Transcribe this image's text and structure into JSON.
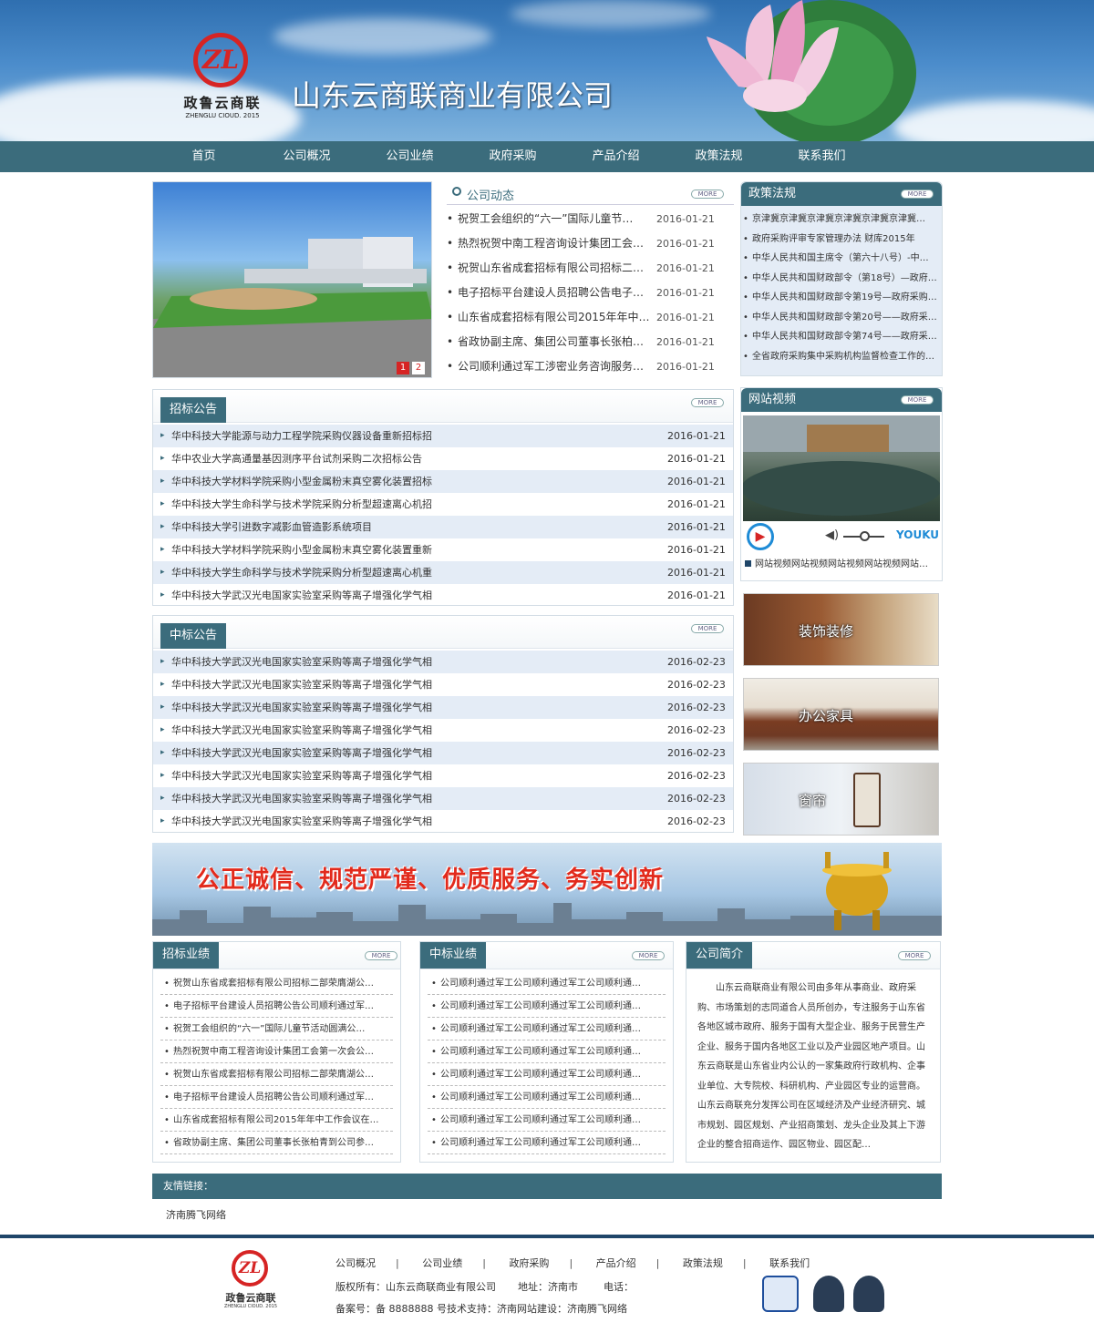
{
  "site": {
    "company_name": "山东云商联商业有限公司",
    "logo_text": "政鲁云商联",
    "logo_sub": "ZHENGLU CIOUD. 2015",
    "logo_mark": "ZL"
  },
  "nav": [
    "首页",
    "公司概况",
    "公司业绩",
    "政府采购",
    "产品介绍",
    "政策法规",
    "联系我们"
  ],
  "more_label": "MORE",
  "slider": {
    "pages": [
      "1",
      "2"
    ]
  },
  "news": {
    "title": "公司动态",
    "items": [
      {
        "title": "祝贺工会组织的“六一”国际儿童节…",
        "date": "2016-01-21"
      },
      {
        "title": "热烈祝贺中南工程咨询设计集团工会…",
        "date": "2016-01-21"
      },
      {
        "title": "祝贺山东省成套招标有限公司招标二…",
        "date": "2016-01-21"
      },
      {
        "title": "电子招标平台建设人员招聘公告电子…",
        "date": "2016-01-21"
      },
      {
        "title": "山东省成套招标有限公司2015年年中…",
        "date": "2016-01-21"
      },
      {
        "title": "省政协副主席、集团公司董事长张柏…",
        "date": "2016-01-21"
      },
      {
        "title": "公司顺利通过军工涉密业务咨询服务…",
        "date": "2016-01-21"
      }
    ]
  },
  "law": {
    "title": "政策法规",
    "items": [
      "京津冀京津冀京津冀京津冀京津冀京津冀…",
      "政府采购评审专家管理办法 财库2015年",
      "中华人民共和国主席令（第六十八号）-中…",
      "中华人民共和国财政部令（第18号）—政府…",
      "中华人民共和国财政部令第19号—政府采购…",
      "中华人民共和国财政部令第20号——政府采…",
      "中华人民共和国财政部令第74号——政府采…",
      "全省政府采购集中采购机构监督检查工作的…"
    ]
  },
  "bidding": {
    "title": "招标公告",
    "items": [
      {
        "title": "华中科技大学能源与动力工程学院采购仪器设备重新招标招",
        "date": "2016-01-21"
      },
      {
        "title": "华中农业大学高通量基因测序平台试剂采购二次招标公告",
        "date": "2016-01-21"
      },
      {
        "title": "华中科技大学材料学院采购小型金属粉末真空雾化装置招标",
        "date": "2016-01-21"
      },
      {
        "title": "华中科技大学生命科学与技术学院采购分析型超速离心机招",
        "date": "2016-01-21"
      },
      {
        "title": "华中科技大学引进数字减影血管造影系统项目",
        "date": "2016-01-21"
      },
      {
        "title": "华中科技大学材料学院采购小型金属粉末真空雾化装置重新",
        "date": "2016-01-21"
      },
      {
        "title": "华中科技大学生命科学与技术学院采购分析型超速离心机重",
        "date": "2016-01-21"
      },
      {
        "title": "华中科技大学武汉光电国家实验室采购等离子增强化学气相",
        "date": "2016-01-21"
      }
    ]
  },
  "winning": {
    "title": "中标公告",
    "items": [
      {
        "title": "华中科技大学武汉光电国家实验室采购等离子增强化学气相",
        "date": "2016-02-23"
      },
      {
        "title": "华中科技大学武汉光电国家实验室采购等离子增强化学气相",
        "date": "2016-02-23"
      },
      {
        "title": "华中科技大学武汉光电国家实验室采购等离子增强化学气相",
        "date": "2016-02-23"
      },
      {
        "title": "华中科技大学武汉光电国家实验室采购等离子增强化学气相",
        "date": "2016-02-23"
      },
      {
        "title": "华中科技大学武汉光电国家实验室采购等离子增强化学气相",
        "date": "2016-02-23"
      },
      {
        "title": "华中科技大学武汉光电国家实验室采购等离子增强化学气相",
        "date": "2016-02-23"
      },
      {
        "title": "华中科技大学武汉光电国家实验室采购等离子增强化学气相",
        "date": "2016-02-23"
      },
      {
        "title": "华中科技大学武汉光电国家实验室采购等离子增强化学气相",
        "date": "2016-02-23"
      }
    ]
  },
  "video": {
    "title": "网站视频",
    "brand": "YOUKU",
    "caption": "网站视频网站视频网站视频网站视频网站…"
  },
  "products": [
    "装饰装修",
    "办公家具",
    "窗帘"
  ],
  "banner_slogan": "公正诚信、规范严谨、优质服务、务实创新",
  "perf_bid": {
    "title": "招标业绩",
    "items": [
      "祝贺山东省成套招标有限公司招标二部荣膺湖公…",
      "电子招标平台建设人员招聘公告公司顺利通过军…",
      "祝贺工会组织的“六一”国际儿童节活动圆满公…",
      "热烈祝贺中南工程咨询设计集团工会第一次会公…",
      "祝贺山东省成套招标有限公司招标二部荣膺湖公…",
      "电子招标平台建设人员招聘公告公司顺利通过军…",
      "山东省成套招标有限公司2015年年中工作会议在…",
      "省政协副主席、集团公司董事长张柏青到公司参…"
    ]
  },
  "perf_win": {
    "title": "中标业绩",
    "items": [
      "公司顺利通过军工公司顺利通过军工公司顺利通…",
      "公司顺利通过军工公司顺利通过军工公司顺利通…",
      "公司顺利通过军工公司顺利通过军工公司顺利通…",
      "公司顺利通过军工公司顺利通过军工公司顺利通…",
      "公司顺利通过军工公司顺利通过军工公司顺利通…",
      "公司顺利通过军工公司顺利通过军工公司顺利通…",
      "公司顺利通过军工公司顺利通过军工公司顺利通…",
      "公司顺利通过军工公司顺利通过军工公司顺利通…"
    ]
  },
  "intro": {
    "title": "公司简介",
    "text": "山东云商联商业有限公司由多年从事商业、政府采购、市场策划的志同道合人员所创办，专注服务于山东省各地区城市政府、服务于国有大型企业、服务于民营生产企业、服务于国内各地区工业以及产业园区地产项目。山东云商联是山东省业内公认的一家集政府行政机构、企事业单位、大专院校、科研机构、产业园区专业的运营商。山东云商联充分发挥公司在区域经济及产业经济研究、城市规划、园区规划、产业招商策划、龙头企业及其上下游企业的整合招商运作、园区物业、园区配…"
  },
  "links": {
    "title": "友情链接：",
    "items": [
      "济南腾飞网络"
    ]
  },
  "footer": {
    "nav": [
      "公司概况",
      "公司业绩",
      "政府采购",
      "产品介绍",
      "政策法规",
      "联系我们"
    ],
    "copyright": "版权所有：山东云商联商业有限公司",
    "address": "地址：济南市",
    "phone": "电话：",
    "icp": "备案号：备 8888888 号技术支持：济南网站建设：济南腾飞网络"
  },
  "colors": {
    "accent": "#3b6c7c",
    "row_alt": "#e4ecf6",
    "footer_bar": "#1f4669"
  }
}
